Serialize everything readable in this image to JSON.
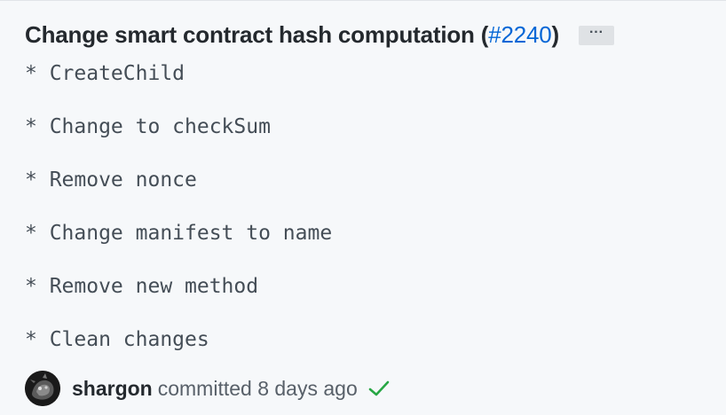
{
  "commit": {
    "title": "Change smart contract hash computation (",
    "pr_link": "#2240",
    "title_suffix": ")",
    "more_label": "···",
    "body_lines": [
      "* CreateChild",
      "* Change to checkSum",
      "* Remove nonce",
      "* Change manifest to name",
      "* Remove new method",
      "* Clean changes"
    ],
    "author": "shargon",
    "meta": "committed 8 days ago",
    "status_icon": "check-icon",
    "status_color": "#28a745"
  },
  "colors": {
    "background": "#f6f8fa",
    "link": "#0366d6",
    "text": "#24292e",
    "muted": "#586069"
  }
}
